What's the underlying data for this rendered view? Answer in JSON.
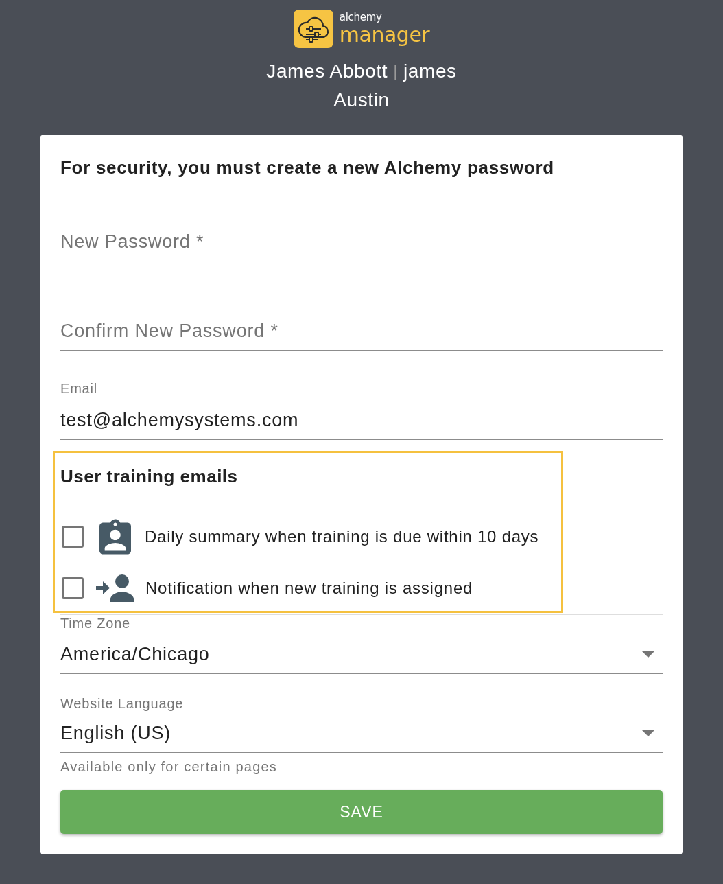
{
  "header": {
    "logo": {
      "small_text": "alchemy",
      "large_text": "manager"
    },
    "user": {
      "full_name": "James Abbott",
      "separator": "|",
      "username": "james",
      "location": "Austin"
    }
  },
  "form": {
    "title": "For security, you must create a new Alchemy password",
    "fields": [
      {
        "kind": "password",
        "placeholder": "New Password *"
      },
      {
        "kind": "password",
        "placeholder": "Confirm New Password *"
      },
      {
        "kind": "text",
        "label": "Email",
        "value": "test@alchemysystems.com"
      }
    ],
    "training_emails": {
      "title": "User training emails",
      "options": [
        {
          "kind": "summary",
          "label": "Daily summary when training is due within 10 days",
          "checked": false
        },
        {
          "kind": "assignment",
          "label": "Notification when new training is assigned",
          "checked": false
        }
      ]
    },
    "selects": [
      {
        "label": "Time Zone",
        "value": "America/Chicago"
      },
      {
        "label": "Website Language",
        "value": "English (US)",
        "helper": "Available only for certain pages"
      }
    ],
    "save_button": "SAVE"
  }
}
